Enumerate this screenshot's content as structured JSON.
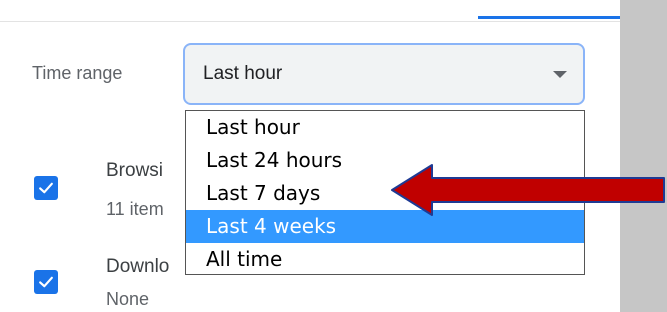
{
  "time_range": {
    "label": "Time range",
    "selected_value": "Last hour",
    "options": [
      {
        "label": "Last hour",
        "highlighted": false
      },
      {
        "label": "Last 24 hours",
        "highlighted": false
      },
      {
        "label": "Last 7 days",
        "highlighted": false
      },
      {
        "label": "Last 4 weeks",
        "highlighted": true
      },
      {
        "label": "All time",
        "highlighted": false
      }
    ]
  },
  "items": [
    {
      "title": "Browsi",
      "subtitle": "11 item",
      "checked": true
    },
    {
      "title": "Downlo",
      "subtitle": "None",
      "checked": true
    }
  ],
  "colors": {
    "accent": "#1a73e8",
    "highlight": "#3399ff",
    "annotation_arrow": "#c00000",
    "background": "#c6c6c6"
  },
  "icons": [
    "check-icon",
    "chevron-down-icon",
    "arrow-annotation"
  ]
}
